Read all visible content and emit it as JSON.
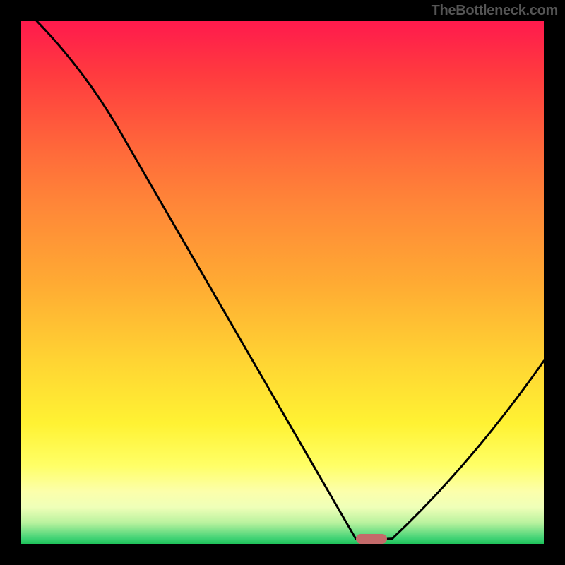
{
  "attribution": "TheBottleneck.com",
  "chart_data": {
    "type": "line",
    "title": "",
    "xlabel": "",
    "ylabel": "",
    "xlim": [
      0,
      100
    ],
    "ylim": [
      0,
      100
    ],
    "grid": false,
    "legend": false,
    "series": [
      {
        "name": "bottleneck-curve",
        "x": [
          3,
          20,
          64,
          71,
          100
        ],
        "y": [
          100,
          77,
          1,
          1,
          35
        ]
      }
    ],
    "marker": {
      "x": 67,
      "y": 1,
      "width_pct": 6,
      "color": "#c46a6a"
    },
    "background_gradient": {
      "type": "vertical",
      "stops": [
        {
          "pct": 0,
          "color": "#ff1a4d"
        },
        {
          "pct": 50,
          "color": "#ffaa33"
        },
        {
          "pct": 85,
          "color": "#ffff66"
        },
        {
          "pct": 100,
          "color": "#1fc25a"
        }
      ]
    }
  }
}
